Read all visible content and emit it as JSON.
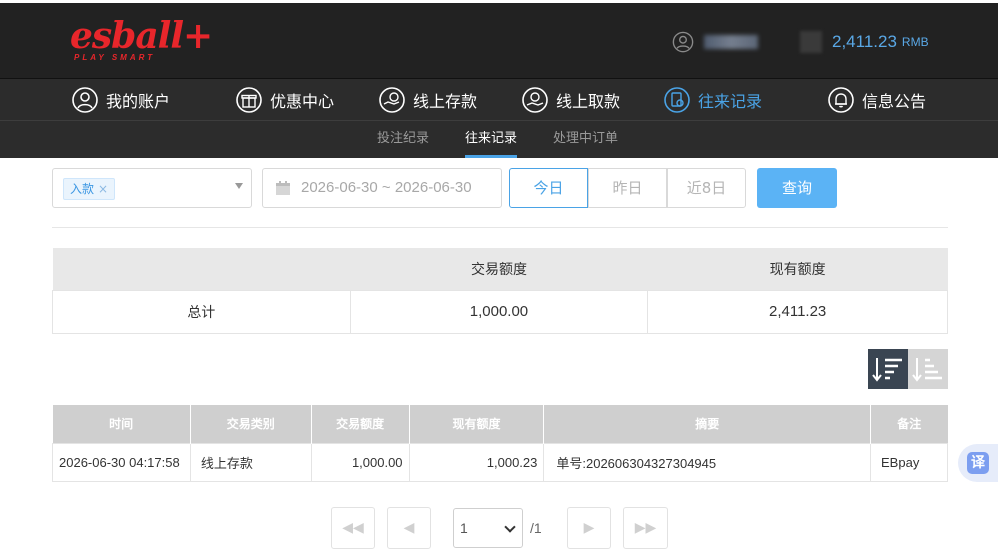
{
  "brand": {
    "logo": "esball+",
    "tagline": "PLAY SMART",
    "color": "#e8262b"
  },
  "header": {
    "balance": "2,411.23",
    "currency": "RMB"
  },
  "main_nav": [
    {
      "label": "我的账户",
      "icon": "user-icon"
    },
    {
      "label": "优惠中心",
      "icon": "gift-icon"
    },
    {
      "label": "线上存款",
      "icon": "deposit-icon"
    },
    {
      "label": "线上取款",
      "icon": "withdraw-icon"
    },
    {
      "label": "往来记录",
      "icon": "record-icon",
      "active": true
    },
    {
      "label": "信息公告",
      "icon": "bell-icon"
    }
  ],
  "sub_nav": [
    {
      "label": "投注纪录"
    },
    {
      "label": "往来记录",
      "active": true
    },
    {
      "label": "处理中订单"
    }
  ],
  "filters": {
    "type_tag": "入款",
    "date_range": "2026-06-30 ~ 2026-06-30",
    "quick_ranges": [
      "今日",
      "昨日",
      "近8日"
    ],
    "query_label": "查询"
  },
  "summary": {
    "headers": [
      "",
      "交易额度",
      "现有额度"
    ],
    "row": [
      "总计",
      "1,000.00",
      "2,411.23"
    ]
  },
  "records": {
    "headers": [
      "时间",
      "交易类别",
      "交易额度",
      "现有额度",
      "摘要",
      "备注"
    ],
    "rows": [
      [
        "2026-06-30 04:17:58",
        "线上存款",
        "1,000.00",
        "1,000.23",
        "单号:202606304327304945",
        "EBpay"
      ]
    ]
  },
  "translate": {
    "label": "译"
  },
  "pagination": {
    "current": "1",
    "total": "/1"
  },
  "colors": {
    "accent": "#4aa3e6",
    "query_button": "#5bb3f5",
    "nav_bg": "#2c2c2c"
  }
}
